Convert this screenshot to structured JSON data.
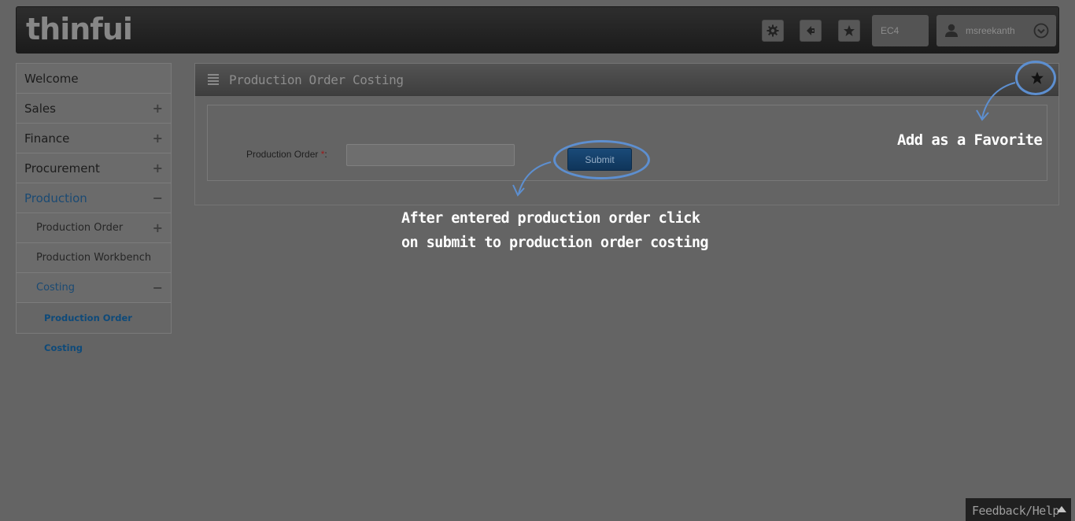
{
  "app": {
    "logo_text": "thinfui",
    "company": "EC4",
    "username": "msreekanth",
    "icons": [
      "gear-icon",
      "theme-icon",
      "star-icon",
      "user-icon",
      "chevron-down-icon"
    ]
  },
  "sidebar": {
    "items": [
      {
        "label": "Welcome",
        "toggle": ""
      },
      {
        "label": "Sales",
        "toggle": "+"
      },
      {
        "label": "Finance",
        "toggle": "+"
      },
      {
        "label": "Procurement",
        "toggle": "+"
      },
      {
        "label": "Production",
        "toggle": "−"
      },
      {
        "label": "Production Order",
        "toggle": "+"
      },
      {
        "label": "Production Workbench",
        "toggle": ""
      },
      {
        "label": "Costing",
        "toggle": "−"
      },
      {
        "label": "Production Order Costing",
        "toggle": ""
      }
    ]
  },
  "main": {
    "title": "Production Order Costing",
    "form": {
      "field_label": "Production Order",
      "required_mark": "*",
      "field_suffix": ":",
      "field_value": "",
      "submit_label": "Submit"
    }
  },
  "annotations": {
    "favorite_note": "Add as a Favorite",
    "submit_note": "After entered production order click\non submit to production order costing",
    "ring_color": "#5d8fd0"
  },
  "footer": {
    "feedback_label": "Feedback/Help"
  }
}
